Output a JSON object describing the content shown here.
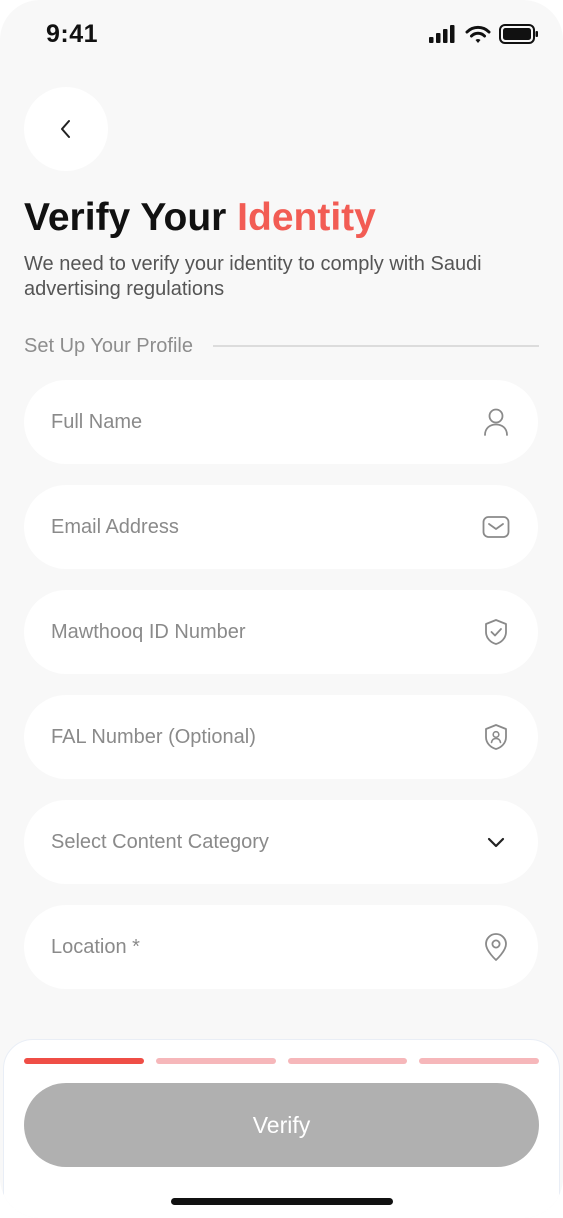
{
  "status_bar": {
    "time": "9:41"
  },
  "header": {
    "back_icon": "chevron-left-icon",
    "title_main": "Verify Your ",
    "title_accent": "Identity",
    "subtitle": "We need to verify your identity to comply with Saudi advertising regulations"
  },
  "section": {
    "label": "Set Up Your Profile"
  },
  "form": {
    "full_name": {
      "placeholder": "Full Name",
      "icon": "user-icon"
    },
    "email": {
      "placeholder": "Email Address",
      "icon": "mail-icon"
    },
    "mawthooq_id": {
      "placeholder": "Mawthooq ID Number",
      "icon": "shield-check-icon"
    },
    "fal_number": {
      "placeholder": "FAL Number (Optional)",
      "icon": "shield-user-icon"
    },
    "content_category": {
      "placeholder": "Select Content Category",
      "icon": "chevron-down-icon"
    },
    "location": {
      "placeholder": "Location *",
      "icon": "location-pin-icon"
    }
  },
  "progress": {
    "current_step": 1,
    "total_steps": 4
  },
  "actions": {
    "verify_label": "Verify"
  },
  "colors": {
    "accent": "#f25c54",
    "progress_active": "#ef4e46",
    "progress_inactive": "#f6b7ba",
    "button_disabled": "#b0b0b0",
    "background": "#f8f8f8"
  }
}
